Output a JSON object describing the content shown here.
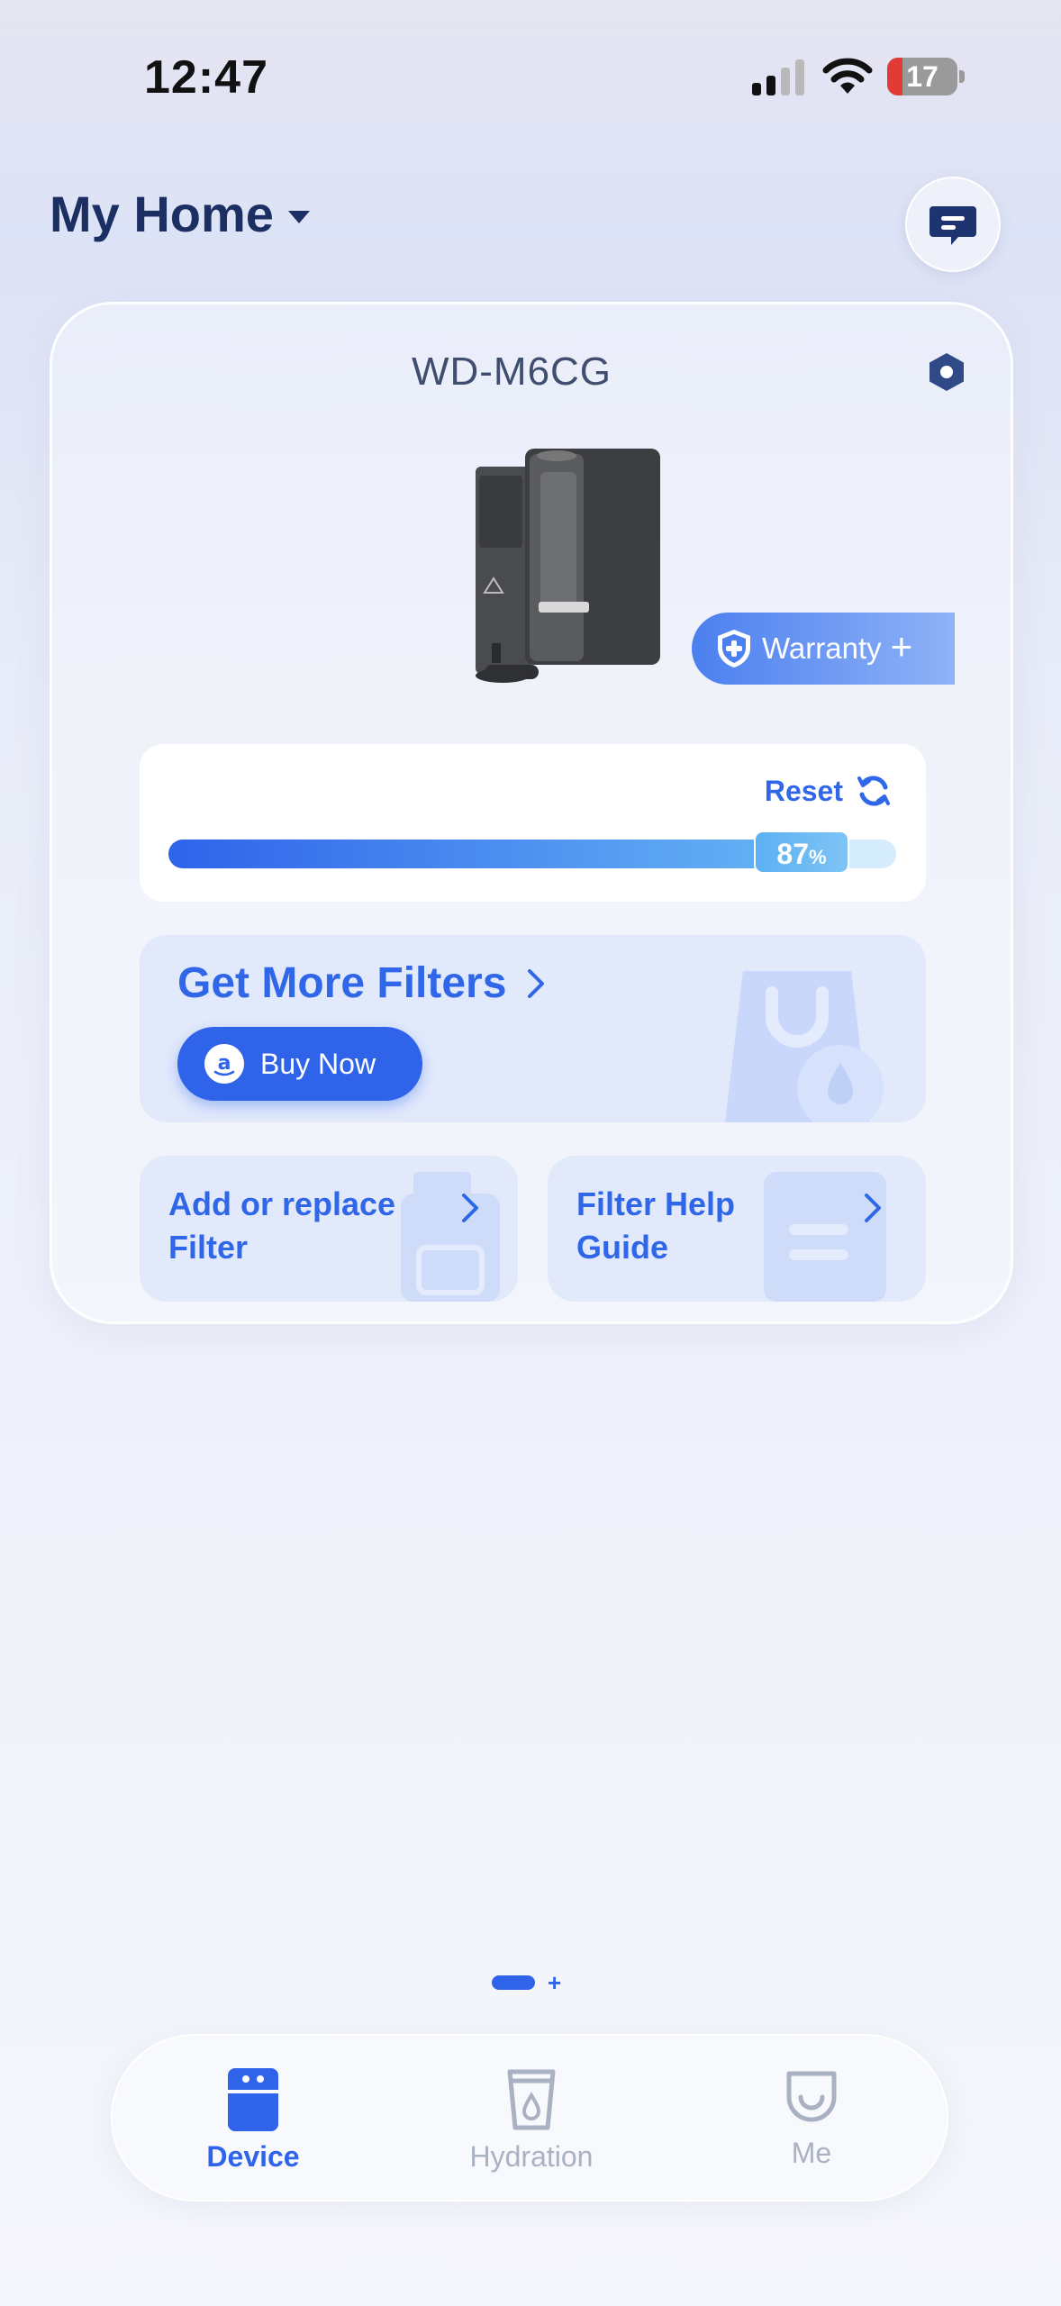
{
  "status_bar": {
    "time": "12:47",
    "battery_level": "17",
    "battery_color": "#e23b35"
  },
  "header": {
    "home_title": "My Home",
    "message_icon": "message-icon"
  },
  "device_card": {
    "device_name": "WD-M6CG",
    "settings_icon": "hexagon-settings-icon",
    "warranty_label": "Warranty",
    "filter": {
      "reset_label": "Reset",
      "percent_value": 87,
      "percent_text": "87",
      "percent_symbol": "%"
    },
    "get_filters": {
      "title": "Get More Filters",
      "buy_label": "Buy Now"
    },
    "tiles": {
      "add_replace_line1": "Add or replace",
      "add_replace_line2": "Filter",
      "help_line1": "Filter Help",
      "help_line2": "Guide"
    }
  },
  "tabbar": {
    "tabs": [
      {
        "label": "Device",
        "icon": "device-icon",
        "active": true
      },
      {
        "label": "Hydration",
        "icon": "hydration-icon",
        "active": false
      },
      {
        "label": "Me",
        "icon": "me-icon",
        "active": false
      }
    ]
  },
  "colors": {
    "accent": "#2e63ea",
    "title_navy": "#1c2f63",
    "inactive_tab": "#a9b1c3"
  }
}
